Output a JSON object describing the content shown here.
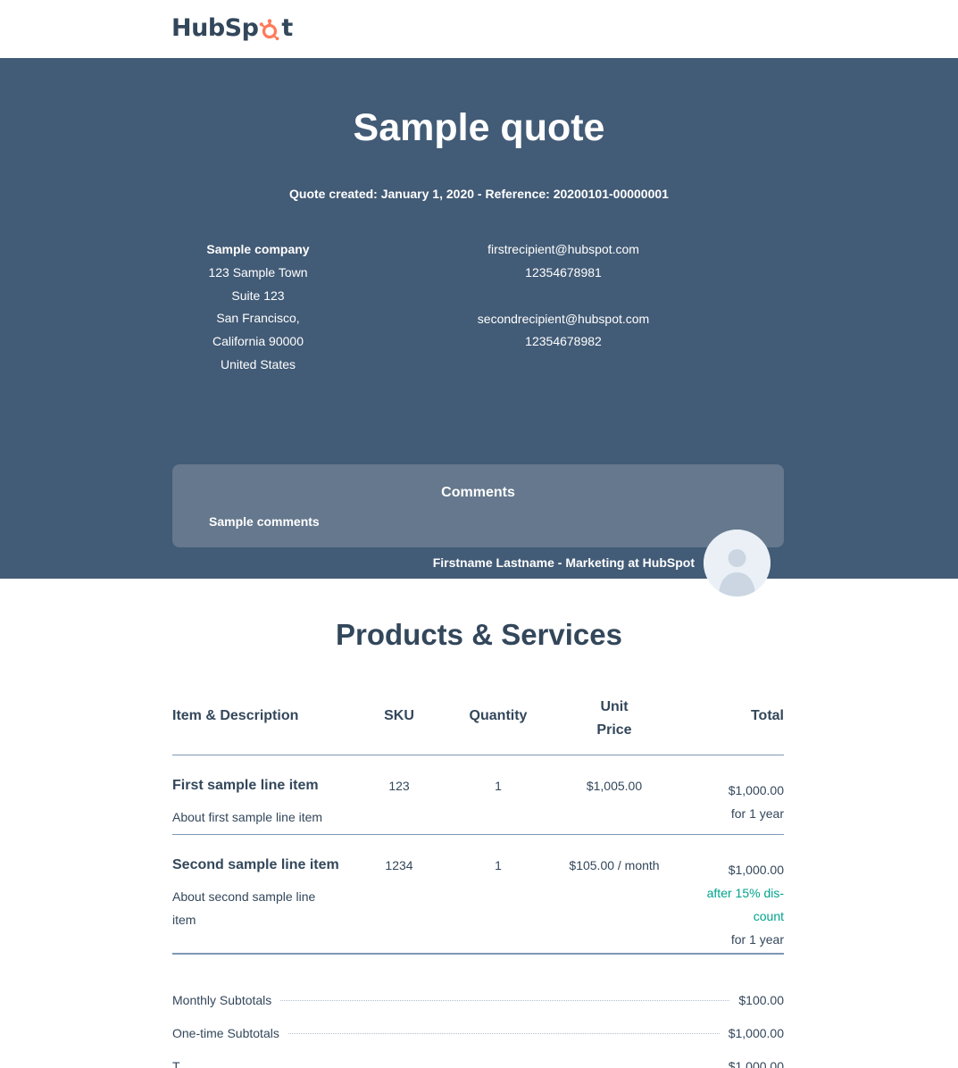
{
  "brand": {
    "name_prefix": "HubSp",
    "name_suffix": "t",
    "accent": "#ff7a59"
  },
  "colors": {
    "band": "#425b76",
    "comments": "#65788d",
    "text": "#33475b",
    "discount": "#00a38d"
  },
  "quote": {
    "title": "Sample quote",
    "meta": "Quote created: January 1, 2020 - Reference: 20200101-00000001"
  },
  "company": {
    "name": "Sample company",
    "address": [
      "123 Sample Town",
      "Suite 123",
      "San Francisco,",
      "California 90000",
      "United States"
    ]
  },
  "recipients": [
    {
      "email": "firstrecipient@hubspot.com",
      "phone": "12354678981"
    },
    {
      "email": "secondrecipient@hubspot.com",
      "phone": "12354678982"
    }
  ],
  "comments": {
    "heading": "Comments",
    "body": "Sample comments"
  },
  "signer": {
    "text": "Firstname Lastname -  Marketing at HubSpot",
    "avatar_icon": "user-avatar-icon"
  },
  "products": {
    "title": "Products & Services",
    "columns": {
      "item": "Item & Description",
      "sku": "SKU",
      "quantity": "Quantity",
      "unit_line1": "Unit",
      "unit_line2": "Price",
      "total": "Total"
    },
    "items": [
      {
        "name": "First sample line item",
        "description": "About first sample line item",
        "sku": "123",
        "quantity": "1",
        "unit_price": "$1,005.00",
        "total": "$1,000.00",
        "term": "for 1 year"
      },
      {
        "name": "Second sample line item",
        "description": "About second sample line item",
        "sku": "1234",
        "quantity": "1",
        "unit_price": "$105.00 / month",
        "total": "$1,000.00",
        "discount_line1": "after 15% dis-",
        "discount_line2": "count",
        "term": "for 1 year"
      }
    ]
  },
  "subtotals": [
    {
      "label": "Monthly Subtotals",
      "value": "$100.00"
    },
    {
      "label": "One-time Subtotals",
      "value": "$1,000.00"
    },
    {
      "label": "T",
      "value": "$1,000.00"
    }
  ]
}
